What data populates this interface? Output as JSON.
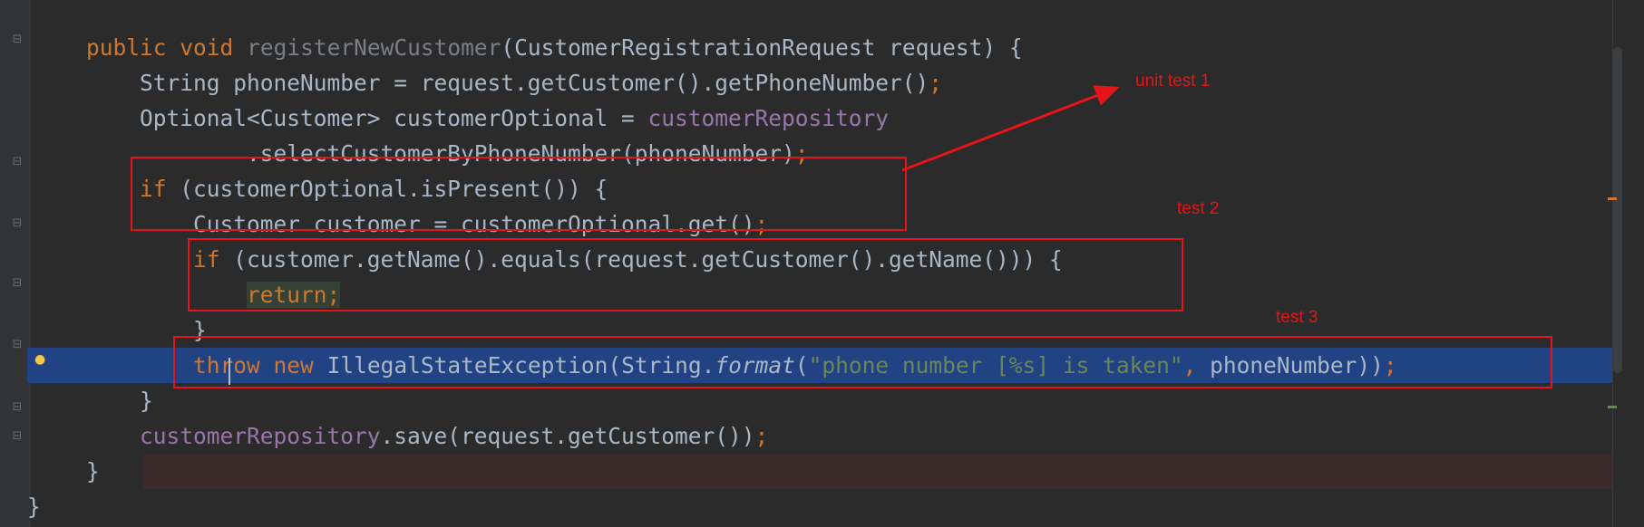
{
  "editor": {
    "lines": [
      "public void registerNewCustomer(CustomerRegistrationRequest request) {",
      "    String phoneNumber = request.getCustomer().getPhoneNumber();",
      "    Optional<Customer> customerOptional = customerRepository",
      "            .selectCustomerByPhoneNumber(phoneNumber);",
      "    if (customerOptional.isPresent()) {",
      "        Customer customer = customerOptional.get();",
      "        if (customer.getName().equals(request.getCustomer().getName())) {",
      "            return;",
      "        }",
      "        throw new IllegalStateException(String.format(\"phone number [%s] is taken\", phoneNumber));",
      "    }",
      "    customerRepository.save(request.getCustomer());",
      "}",
      "}"
    ],
    "tokens": {
      "l0": [
        "public",
        "void",
        "registerNewCustomer",
        "(CustomerRegistrationRequest request) {"
      ],
      "l1": [
        "String phoneNumber = request.getCustomer().getPhoneNumber()",
        ";"
      ],
      "l2": [
        "Optional<Customer> customerOptional = ",
        "customerRepository"
      ],
      "l3": [
        ".selectCustomerByPhoneNumber(phoneNumber)",
        ";"
      ],
      "l4": [
        "if",
        " (customerOptional.isPresent()) {"
      ],
      "l5": [
        "Customer customer = customerOptional.get()",
        ";"
      ],
      "l6": [
        "if",
        " (customer.getName().equals(request.getCustomer().getName())) {"
      ],
      "l7": [
        "return;"
      ],
      "l8": [
        "}"
      ],
      "l9": [
        "throw",
        "new",
        "IllegalStateException(String.",
        "format",
        "(",
        "\"phone number [%s] is taken\"",
        ",",
        " phoneNumber))",
        ";"
      ],
      "l10": [
        "}"
      ],
      "l11": [
        "customerRepository",
        ".save(request.getCustomer())",
        ";"
      ],
      "l12": [
        "}"
      ],
      "l13": [
        "}"
      ]
    }
  },
  "annotations": {
    "note1": "unit test 1",
    "note2": "test 2",
    "note3": "test 3"
  },
  "colors": {
    "background": "#2b2b2b",
    "keyword": "#cc7832",
    "string": "#6a8759",
    "field": "#9876aa",
    "selection": "#214283",
    "annotation": "#e5141b"
  },
  "icons": {
    "fold": "fold-marker-icon",
    "bulb": "lightbulb-icon"
  }
}
